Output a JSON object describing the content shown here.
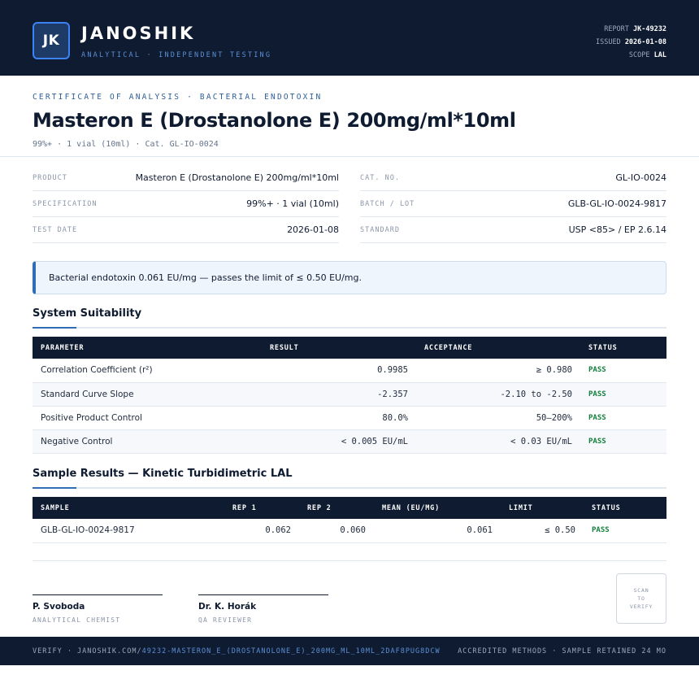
{
  "header": {
    "logo_text": "JK",
    "brand": "JANOSHIK",
    "tagline": "ANALYTICAL · INDEPENDENT TESTING",
    "report_label": "REPORT",
    "report_value": "JK-49232",
    "issued_label": "ISSUED",
    "issued_value": "2026-01-08",
    "scope_label": "SCOPE",
    "scope_value": "LAL"
  },
  "title_block": {
    "kicker": "CERTIFICATE OF ANALYSIS · BACTERIAL ENDOTOXIN",
    "title": "Masteron E (Drostanolone E) 200mg/ml*10ml",
    "subtitle": "99%+ · 1 vial (10ml)  ·  Cat. GL-IO-0024"
  },
  "info_left": [
    {
      "label": "PRODUCT",
      "value": "Masteron E (Drostanolone E) 200mg/ml*10ml"
    },
    {
      "label": "SPECIFICATION",
      "value": "99%+ · 1 vial (10ml)"
    },
    {
      "label": "TEST DATE",
      "value": "2026-01-08"
    }
  ],
  "info_right": [
    {
      "label": "CAT. NO.",
      "value": "GL-IO-0024"
    },
    {
      "label": "BATCH / LOT",
      "value": "GLB-GL-IO-0024-9817"
    },
    {
      "label": "STANDARD",
      "value": "USP <85> / EP 2.6.14"
    }
  ],
  "banner": "Bacterial endotoxin 0.061 EU/mg — passes the limit of ≤ 0.50 EU/mg.",
  "system_suitability": {
    "title": "System Suitability",
    "headers": [
      "PARAMETER",
      "RESULT",
      "ACCEPTANCE",
      "STATUS"
    ],
    "rows": [
      {
        "parameter": "Correlation Coefficient (r²)",
        "result": "0.9985",
        "acceptance": "≥ 0.980",
        "status": "PASS"
      },
      {
        "parameter": "Standard Curve Slope",
        "result": "-2.357",
        "acceptance": "-2.10 to -2.50",
        "status": "PASS"
      },
      {
        "parameter": "Positive Product Control",
        "result": "80.0%",
        "acceptance": "50–200%",
        "status": "PASS"
      },
      {
        "parameter": "Negative Control",
        "result": "< 0.005 EU/mL",
        "acceptance": "< 0.03 EU/mL",
        "status": "PASS"
      }
    ]
  },
  "sample_results": {
    "title": "Sample Results — Kinetic Turbidimetric LAL",
    "headers": [
      "SAMPLE",
      "REP 1",
      "REP 2",
      "MEAN (EU/MG)",
      "LIMIT",
      "STATUS"
    ],
    "rows": [
      {
        "sample": "GLB-GL-IO-0024-9817",
        "rep1": "0.062",
        "rep2": "0.060",
        "mean": "0.061",
        "limit": "≤ 0.50",
        "status": "PASS"
      }
    ]
  },
  "signatures": [
    {
      "name": "P. Svoboda",
      "role": "ANALYTICAL CHEMIST"
    },
    {
      "name": "Dr. K. Horák",
      "role": "QA REVIEWER"
    }
  ],
  "qr": {
    "line1": "SCAN",
    "line2": "TO",
    "line3": "VERIFY"
  },
  "footer": {
    "verify_prefix": "VERIFY · JANOSHIK.COM/",
    "verify_path": "49232-MASTERON_E_(DROSTANOLONE_E)_200MG_ML_10ML_2DAF8PUG8DCW",
    "right": "ACCREDITED METHODS · SAMPLE RETAINED 24 MO"
  },
  "colors": {
    "navy": "#0f1b30",
    "accent_blue": "#2f6db5",
    "pass_green": "#15803d"
  }
}
